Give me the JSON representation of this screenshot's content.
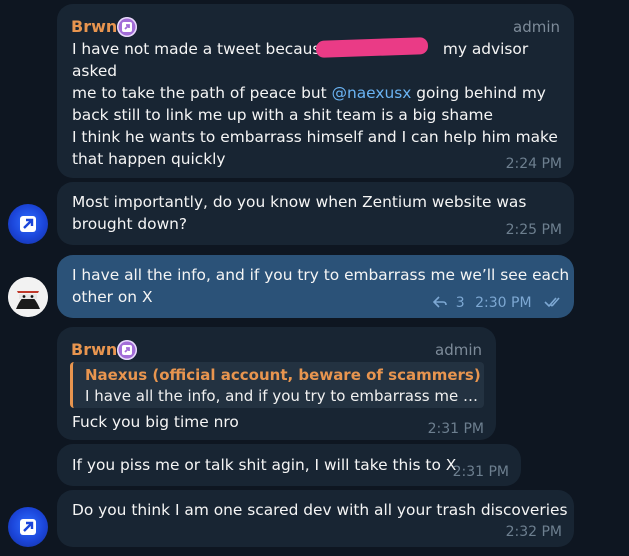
{
  "messages": [
    {
      "sender": "Brwn",
      "role": "admin",
      "lines_a": [
        "I have not made a tweet because ",
        "my advisor asked"
      ],
      "line_b": "me to take the path of peace but ",
      "mention": "@naexusx",
      "line_b2": " going behind my",
      "line_c": "back still to link me up with a shit team is a big shame",
      "para2": "I think he wants to embarrass himself and I can help him make\nthat happen quickly",
      "time": "2:24 PM"
    },
    {
      "text": "Most importantly, do you know when Zentium website was\nbrought down?",
      "time": "2:25 PM"
    },
    {
      "text": "I have all the info, and if you try to embarrass me we’ll see each\nother on X",
      "reply_count": "3",
      "time": "2:30 PM"
    },
    {
      "sender": "Brwn",
      "role": "admin",
      "reply_name": "Naexus (official account, beware of scammers)",
      "reply_text": "I have all the info, and if you try to embarrass me …",
      "text": "Fuck you big time nro",
      "time": "2:31 PM"
    },
    {
      "text": "If you piss me or talk shit agin, I will take this to X",
      "time": "2:31 PM"
    },
    {
      "text": "Do you think I am one scared dev with all your trash discoveries",
      "time": "2:32 PM"
    }
  ],
  "colors": {
    "background": "#0e1621",
    "incoming_bubble": "#182533",
    "outgoing_bubble": "#2b5278",
    "sender_name": "#e8954f",
    "mention": "#6ab3f3",
    "redaction": "#ea3b86"
  },
  "icons": {
    "badge": "purple-verified-badge",
    "reply": "reply-arrow-icon",
    "read": "double-check-icon"
  }
}
